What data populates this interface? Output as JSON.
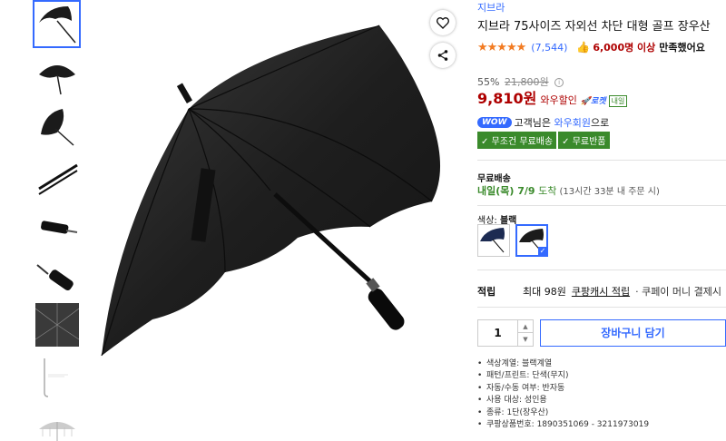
{
  "product": {
    "brand": "지브라",
    "title": "지브라 75사이즈 자외선 차단 대형 골프 장우산",
    "rating": {
      "stars": "★★★★★",
      "review_count": "(7,544)",
      "satisfied_icon": "thumbs-up-icon",
      "satisfied_count": "6,000명 이상",
      "satisfied_text": "만족했어요"
    },
    "price": {
      "discount_rate": "55%",
      "original_price": "21,800원",
      "info_icon": "i",
      "sale_price": "9,810원",
      "wow_label": "와우할인",
      "rocket_label": "로켓",
      "tomorrow_label": "내일"
    },
    "wow": {
      "badge": "WOW",
      "text_prefix": "고객님은 ",
      "member": "와우회원",
      "text_suffix": "으로"
    },
    "benefits": [
      "✓ 무조건 무료배송",
      "✓ 무료반품"
    ],
    "shipping": {
      "label": "무료배송",
      "date": "내일(목) 7/9",
      "arrive": " 도착",
      "note": " (13시간 33분 내 주문 시)"
    },
    "color": {
      "label": "색상:",
      "selected": "블랙",
      "options": [
        "navy",
        "black"
      ]
    },
    "points": {
      "label": "적립",
      "max": "최대 98원",
      "link": "쿠팡캐시 적립",
      "extra": "· 쿠페이 머니 결제시"
    },
    "quantity": "1",
    "cart_button": "장바구니 담기",
    "specs": [
      "색상계열: 블랙계열",
      "패턴/프린트: 단색(무지)",
      "자동/수동 여부: 반자동",
      "사용 대상: 성인용",
      "종류: 1단(장우산)",
      "쿠팡상품번호: 1890351069 - 3211973019"
    ]
  },
  "colors": {
    "accent": "#346aff",
    "price_red": "#ae0000",
    "green": "#3a8a2b",
    "star": "#f27b22"
  },
  "icons": {
    "favorite": "heart-icon",
    "share": "share-icon"
  }
}
